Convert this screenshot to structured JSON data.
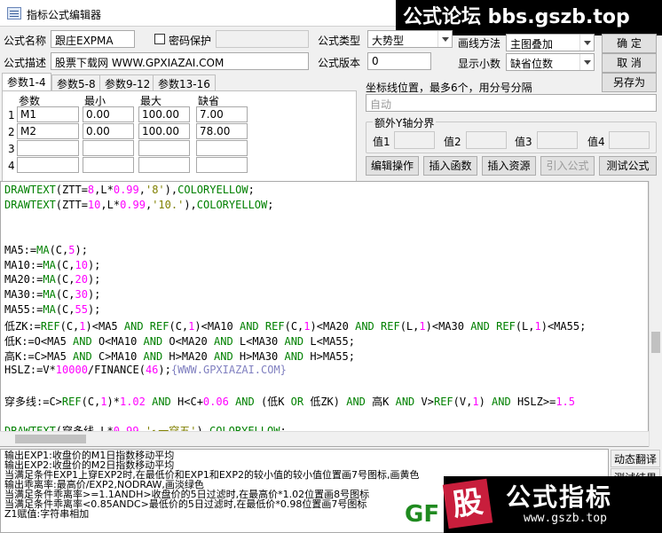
{
  "window": {
    "title": "指标公式编辑器"
  },
  "banner": {
    "text": "公式论坛 bbs.gszb.top"
  },
  "form": {
    "name_label": "公式名称",
    "name_value": "跟庄EXPMA",
    "password_label": "密码保护",
    "type_label": "公式类型",
    "type_value": "大势型",
    "draw_label": "画线方法",
    "draw_value": "主图叠加",
    "desc_label": "公式描述",
    "desc_value": "股票下载网 WWW.GPXIAZAI.COM",
    "version_label": "公式版本",
    "version_value": "0",
    "decimal_label": "显示小数",
    "decimal_value": "缺省位数"
  },
  "buttons": {
    "confirm": "确 定",
    "cancel": "取 消",
    "save_as": "另存为",
    "edit_ops": "编辑操作",
    "insert_func": "插入函数",
    "insert_res": "插入资源",
    "import_formula": "引入公式",
    "test_formula": "测试公式",
    "dynamic_translate": "动态翻译",
    "test_result": "测试结果"
  },
  "tabs": [
    "参数1-4",
    "参数5-8",
    "参数9-12",
    "参数13-16"
  ],
  "params": {
    "headers": [
      "参数",
      "最小",
      "最大",
      "缺省"
    ],
    "rows": [
      {
        "idx": "1",
        "name": "M1",
        "min": "0.00",
        "max": "100.00",
        "def": "7.00"
      },
      {
        "idx": "2",
        "name": "M2",
        "min": "0.00",
        "max": "100.00",
        "def": "78.00"
      },
      {
        "idx": "3",
        "name": "",
        "min": "",
        "max": "",
        "def": ""
      },
      {
        "idx": "4",
        "name": "",
        "min": "",
        "max": "",
        "def": ""
      }
    ]
  },
  "axis": {
    "label": "坐标线位置，最多6个，用分号分隔",
    "placeholder": "自动",
    "extra_y_label": "额外Y轴分界",
    "v1": "值1",
    "v2": "值2",
    "v3": "值3",
    "v4": "值4"
  },
  "code": [
    [
      {
        "t": "DRAWTEXT",
        "c": "fn"
      },
      {
        "t": "(ZTT=",
        "c": ""
      },
      {
        "t": "8",
        "c": "num"
      },
      {
        "t": ",L*",
        "c": ""
      },
      {
        "t": "0.99",
        "c": "num"
      },
      {
        "t": ",",
        "c": ""
      },
      {
        "t": "'8'",
        "c": "str"
      },
      {
        "t": "),",
        "c": ""
      },
      {
        "t": "COLORYELLOW",
        "c": "fn"
      },
      {
        "t": ";",
        "c": ""
      }
    ],
    [
      {
        "t": "DRAWTEXT",
        "c": "fn"
      },
      {
        "t": "(ZTT=",
        "c": ""
      },
      {
        "t": "10",
        "c": "num"
      },
      {
        "t": ",L*",
        "c": ""
      },
      {
        "t": "0.99",
        "c": "num"
      },
      {
        "t": ",",
        "c": ""
      },
      {
        "t": "'10.'",
        "c": "str"
      },
      {
        "t": "),",
        "c": ""
      },
      {
        "t": "COLORYELLOW",
        "c": "fn"
      },
      {
        "t": ";",
        "c": ""
      }
    ],
    [],
    [],
    [
      {
        "t": "MA5:=",
        "c": ""
      },
      {
        "t": "MA",
        "c": "fn"
      },
      {
        "t": "(C,",
        "c": ""
      },
      {
        "t": "5",
        "c": "num"
      },
      {
        "t": ");",
        "c": ""
      }
    ],
    [
      {
        "t": "MA10:=",
        "c": ""
      },
      {
        "t": "MA",
        "c": "fn"
      },
      {
        "t": "(C,",
        "c": ""
      },
      {
        "t": "10",
        "c": "num"
      },
      {
        "t": ");",
        "c": ""
      }
    ],
    [
      {
        "t": "MA20:=",
        "c": ""
      },
      {
        "t": "MA",
        "c": "fn"
      },
      {
        "t": "(C,",
        "c": ""
      },
      {
        "t": "20",
        "c": "num"
      },
      {
        "t": ");",
        "c": ""
      }
    ],
    [
      {
        "t": "MA30:=",
        "c": ""
      },
      {
        "t": "MA",
        "c": "fn"
      },
      {
        "t": "(C,",
        "c": ""
      },
      {
        "t": "30",
        "c": "num"
      },
      {
        "t": ");",
        "c": ""
      }
    ],
    [
      {
        "t": "MA55:=",
        "c": ""
      },
      {
        "t": "MA",
        "c": "fn"
      },
      {
        "t": "(C,",
        "c": ""
      },
      {
        "t": "55",
        "c": "num"
      },
      {
        "t": ");",
        "c": ""
      }
    ],
    [
      {
        "t": "低ZK:=",
        "c": ""
      },
      {
        "t": "REF",
        "c": "fn"
      },
      {
        "t": "(C,",
        "c": ""
      },
      {
        "t": "1",
        "c": "num"
      },
      {
        "t": ")<MA5 ",
        "c": ""
      },
      {
        "t": "AND",
        "c": "fn"
      },
      {
        "t": " ",
        "c": ""
      },
      {
        "t": "REF",
        "c": "fn"
      },
      {
        "t": "(C,",
        "c": ""
      },
      {
        "t": "1",
        "c": "num"
      },
      {
        "t": ")<MA10 ",
        "c": ""
      },
      {
        "t": "AND",
        "c": "fn"
      },
      {
        "t": " ",
        "c": ""
      },
      {
        "t": "REF",
        "c": "fn"
      },
      {
        "t": "(C,",
        "c": ""
      },
      {
        "t": "1",
        "c": "num"
      },
      {
        "t": ")<MA20 ",
        "c": ""
      },
      {
        "t": "AND",
        "c": "fn"
      },
      {
        "t": " ",
        "c": ""
      },
      {
        "t": "REF",
        "c": "fn"
      },
      {
        "t": "(L,",
        "c": ""
      },
      {
        "t": "1",
        "c": "num"
      },
      {
        "t": ")<MA30 ",
        "c": ""
      },
      {
        "t": "AND",
        "c": "fn"
      },
      {
        "t": " ",
        "c": ""
      },
      {
        "t": "REF",
        "c": "fn"
      },
      {
        "t": "(L,",
        "c": ""
      },
      {
        "t": "1",
        "c": "num"
      },
      {
        "t": ")<MA55;",
        "c": ""
      }
    ],
    [
      {
        "t": "低K:=O<MA5 ",
        "c": ""
      },
      {
        "t": "AND",
        "c": "fn"
      },
      {
        "t": " O<MA10 ",
        "c": ""
      },
      {
        "t": "AND",
        "c": "fn"
      },
      {
        "t": " O<MA20 ",
        "c": ""
      },
      {
        "t": "AND",
        "c": "fn"
      },
      {
        "t": " L<MA30 ",
        "c": ""
      },
      {
        "t": "AND",
        "c": "fn"
      },
      {
        "t": " L<MA55;",
        "c": ""
      }
    ],
    [
      {
        "t": "高K:=C>MA5 ",
        "c": ""
      },
      {
        "t": "AND",
        "c": "fn"
      },
      {
        "t": " C>MA10 ",
        "c": ""
      },
      {
        "t": "AND",
        "c": "fn"
      },
      {
        "t": " H>MA20 ",
        "c": ""
      },
      {
        "t": "AND",
        "c": "fn"
      },
      {
        "t": " H>MA30 ",
        "c": ""
      },
      {
        "t": "AND",
        "c": "fn"
      },
      {
        "t": " H>MA55;",
        "c": ""
      }
    ],
    [
      {
        "t": "HSLZ:=V*",
        "c": ""
      },
      {
        "t": "10000",
        "c": "num"
      },
      {
        "t": "/FINANCE(",
        "c": ""
      },
      {
        "t": "46",
        "c": "num"
      },
      {
        "t": ");",
        "c": ""
      },
      {
        "t": "{WWW.GPXIAZAI.COM}",
        "c": "cm"
      }
    ],
    [],
    [
      {
        "t": "穿多线:=C>",
        "c": ""
      },
      {
        "t": "REF",
        "c": "fn"
      },
      {
        "t": "(C,",
        "c": ""
      },
      {
        "t": "1",
        "c": "num"
      },
      {
        "t": ")*",
        "c": ""
      },
      {
        "t": "1.02",
        "c": "num"
      },
      {
        "t": " ",
        "c": ""
      },
      {
        "t": "AND",
        "c": "fn"
      },
      {
        "t": " H<C+",
        "c": ""
      },
      {
        "t": "0.06",
        "c": "num"
      },
      {
        "t": " ",
        "c": ""
      },
      {
        "t": "AND",
        "c": "fn"
      },
      {
        "t": " (低K ",
        "c": ""
      },
      {
        "t": "OR",
        "c": "fn"
      },
      {
        "t": " 低ZK) ",
        "c": ""
      },
      {
        "t": "AND",
        "c": "fn"
      },
      {
        "t": " 高K ",
        "c": ""
      },
      {
        "t": "AND",
        "c": "fn"
      },
      {
        "t": " V>",
        "c": ""
      },
      {
        "t": "REF",
        "c": "fn"
      },
      {
        "t": "(V,",
        "c": ""
      },
      {
        "t": "1",
        "c": "num"
      },
      {
        "t": ") ",
        "c": ""
      },
      {
        "t": "AND",
        "c": "fn"
      },
      {
        "t": " HSLZ>=",
        "c": ""
      },
      {
        "t": "1.5",
        "c": "num"
      }
    ],
    [],
    [
      {
        "t": "DRAWTEXT",
        "c": "fn"
      },
      {
        "t": "(穿多线,L*",
        "c": ""
      },
      {
        "t": "0.99",
        "c": "num"
      },
      {
        "t": ",",
        "c": ""
      },
      {
        "t": "'↖一穿五'",
        "c": "str"
      },
      {
        "t": "),",
        "c": ""
      },
      {
        "t": "COLORYELLOW",
        "c": "fn"
      },
      {
        "t": ";",
        "c": ""
      }
    ]
  ],
  "output": [
    "输出EXP1:收盘价的M1日指数移动平均",
    "输出EXP2:收盘价的M2日指数移动平均",
    "当满足条件EXP1上穿EXP2时,在最低价和EXP1和EXP2的较小值的较小值位置画7号图标,画黄色",
    "输出乖离率:最高价/EXP2,NODRAW,画淡绿色",
    "当满足条件乖离率>=1.1ANDH>收盘价的5日过滤时,在最高价*1.02位置画8号图标",
    "当满足条件乖离率<0.85ANDC>最低价的5日过滤时,在最低价*0.98位置画7号图标",
    "Z1赋值:字符串相加"
  ],
  "logo": {
    "text": "公式指标",
    "url": "www.gszb.top",
    "stock_char": "股",
    "corner_text": "GF"
  },
  "colors": {
    "keyword": "#008000",
    "number": "#ff00ff",
    "string": "#808000",
    "comment": "#8080c0",
    "accent": "#c81e3c"
  }
}
